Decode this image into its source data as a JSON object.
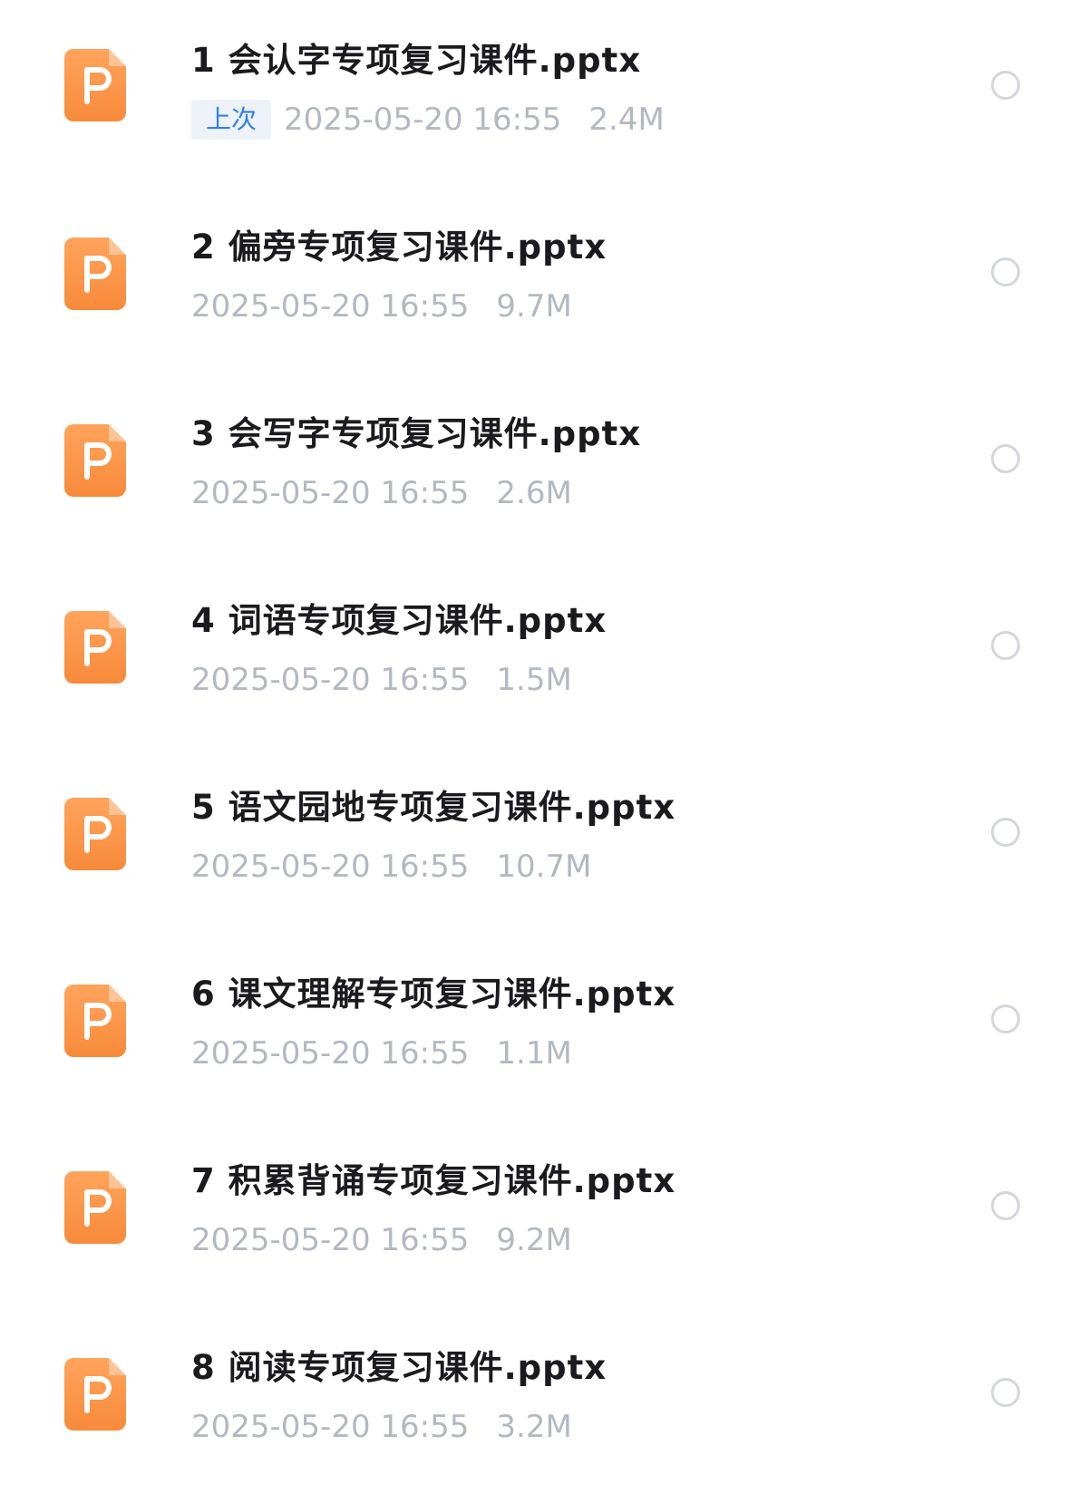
{
  "files": [
    {
      "name": "1 会认字专项复习课件.pptx",
      "badge": "上次",
      "date": "2025-05-20 16:55",
      "size": "2.4M",
      "icon": "pptx-file-icon"
    },
    {
      "name": "2 偏旁专项复习课件.pptx",
      "badge": "",
      "date": "2025-05-20 16:55",
      "size": "9.7M",
      "icon": "pptx-file-icon"
    },
    {
      "name": "3 会写字专项复习课件.pptx",
      "badge": "",
      "date": "2025-05-20 16:55",
      "size": "2.6M",
      "icon": "pptx-file-icon"
    },
    {
      "name": "4 词语专项复习课件.pptx",
      "badge": "",
      "date": "2025-05-20 16:55",
      "size": "1.5M",
      "icon": "pptx-file-icon"
    },
    {
      "name": "5 语文园地专项复习课件.pptx",
      "badge": "",
      "date": "2025-05-20 16:55",
      "size": "10.7M",
      "icon": "pptx-file-icon"
    },
    {
      "name": "6 课文理解专项复习课件.pptx",
      "badge": "",
      "date": "2025-05-20 16:55",
      "size": "1.1M",
      "icon": "pptx-file-icon"
    },
    {
      "name": "7 积累背诵专项复习课件.pptx",
      "badge": "",
      "date": "2025-05-20 16:55",
      "size": "9.2M",
      "icon": "pptx-file-icon"
    },
    {
      "name": "8 阅读专项复习课件.pptx",
      "badge": "",
      "date": "2025-05-20 16:55",
      "size": "3.2M",
      "icon": "pptx-file-icon"
    }
  ],
  "colors": {
    "icon_orange": "#f78a3a",
    "badge_blue": "#2f7ff2",
    "meta_gray": "#b3b8c2",
    "title_black": "#1b1b1f"
  }
}
